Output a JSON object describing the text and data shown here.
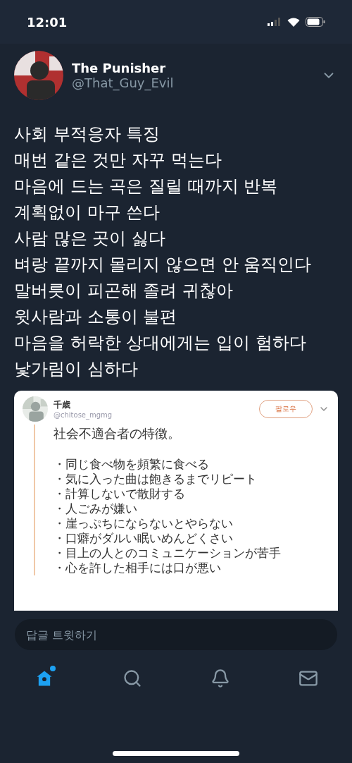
{
  "status_bar": {
    "time": "12:01"
  },
  "tweet": {
    "author": {
      "name": "The Punisher",
      "handle": "@That_Guy_Evil"
    },
    "lines": [
      "사회 부적응자 특징",
      "매번 같은 것만 자꾸 먹는다",
      "마음에 드는 곡은 질릴 때까지 반복",
      "계획없이 마구 쓴다",
      "사람 많은 곳이 싫다",
      "벼랑 끝까지 몰리지 않으면 안 움직인다",
      "말버릇이 피곤해 졸려 귀찮아",
      "윗사람과 소통이 불편",
      "마음을 허락한 상대에게는 입이 험하다",
      "낯가림이 심하다"
    ],
    "embedded_tweet": {
      "author": {
        "name": "千歳",
        "handle": "@chitose_mgmg"
      },
      "follow_button": "팔로우",
      "title": "社会不適合者の特徴。",
      "bullets": [
        "・同じ食べ物を頻繁に食べる",
        "・気に入った曲は飽きるまでリピート",
        "・計算しないで散財する",
        "・人ごみが嫌い",
        "・崖っぷちにならないとやらない",
        "・口癖がダルい眠いめんどくさい",
        "・目上の人とのコミュニケーションが苦手",
        "・心を許した相手には口が悪い"
      ]
    }
  },
  "reply_field": {
    "placeholder": "답글 트윗하기"
  },
  "tab_bar": [
    {
      "kind": "home",
      "selected": true,
      "badge": true
    },
    {
      "kind": "search",
      "selected": false,
      "badge": false
    },
    {
      "kind": "notifications",
      "selected": false,
      "badge": false
    },
    {
      "kind": "messages",
      "selected": false,
      "badge": false
    }
  ]
}
